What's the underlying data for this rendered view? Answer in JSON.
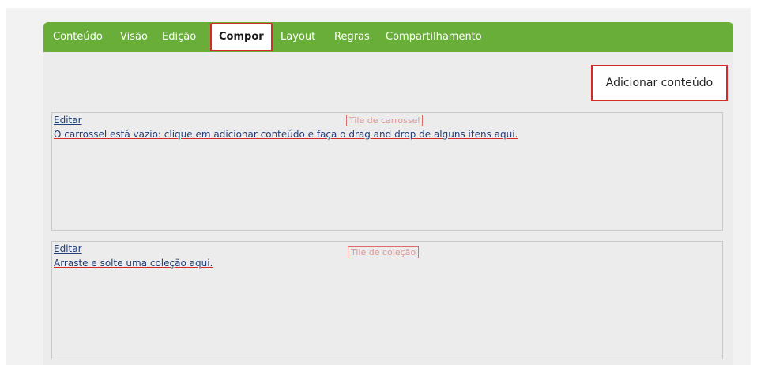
{
  "tabs": [
    {
      "label": "Conteúdo"
    },
    {
      "label": "Visão"
    },
    {
      "label": "Edição"
    },
    {
      "label": "Compor"
    },
    {
      "label": "Layout"
    },
    {
      "label": "Regras"
    },
    {
      "label": "Compartilhamento"
    }
  ],
  "active_tab": "Compor",
  "add_content_label": "Adicionar conteúdo",
  "tiles": [
    {
      "edit_label": "Editar",
      "title": "Tile de carrossel",
      "message": "O carrossel está vazio: clique em adicionar conteúdo e faça o drag and drop de alguns itens aqui."
    },
    {
      "edit_label": "Editar",
      "title": "Tile de coleção",
      "message": "Arraste e solte uma coleção aqui."
    }
  ],
  "colors": {
    "tab_bar": "#6aae3a",
    "highlight": "#d42a2a",
    "link": "#1f3f7a"
  }
}
